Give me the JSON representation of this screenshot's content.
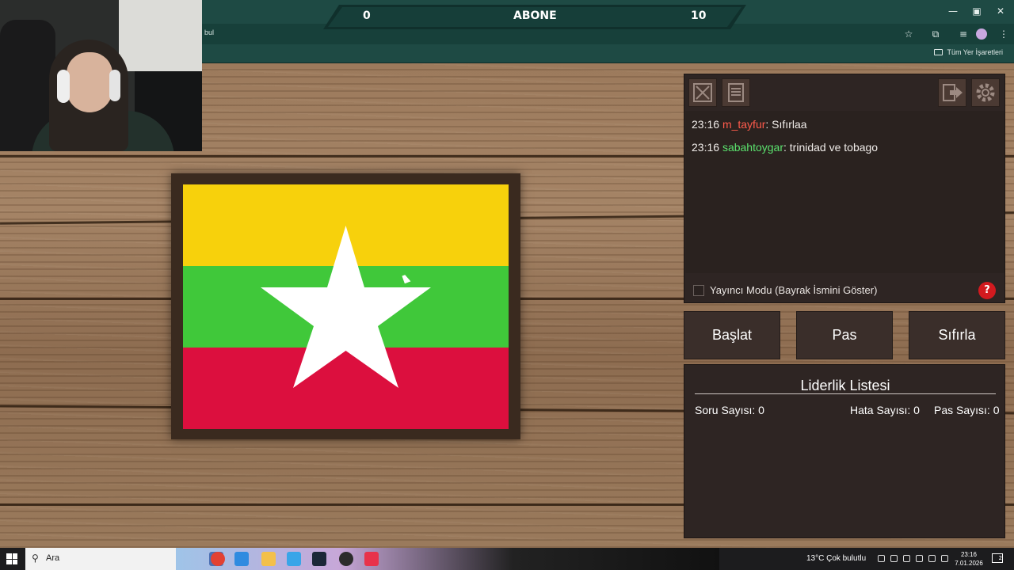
{
  "browser": {
    "address_fragment": "bul",
    "bookmarks_label": "Tüm Yer İşaretleri",
    "window_controls": [
      "minimize-icon",
      "restore-icon",
      "close-icon"
    ]
  },
  "score": {
    "left": "0",
    "label": "ABONE",
    "right": "10"
  },
  "flag": {
    "colors": {
      "top": "#f7d10c",
      "middle": "#40c83a",
      "bottom": "#dc0f3e",
      "star": "#ffffff"
    }
  },
  "toolbar": {
    "left_icons": [
      "fullscreen-icon",
      "list-icon"
    ],
    "right_icons": [
      "exit-icon",
      "settings-icon"
    ]
  },
  "chat": {
    "messages": [
      {
        "time": "23:16",
        "user": "m_tayfur",
        "text": ": Sıfırlaa"
      },
      {
        "time": "23:16",
        "user": "sabahtoygar",
        "text": ": trinidad ve tobago"
      }
    ]
  },
  "streamer_mode": {
    "label": "Yayıncı Modu (Bayrak İsmini Göster)",
    "checked": false,
    "help": "?"
  },
  "actions": {
    "start": "Başlat",
    "pass": "Pas",
    "reset": "Sıfırla"
  },
  "leaderboard": {
    "title": "Liderlik Listesi",
    "questions": "Soru Sayısı: 0",
    "errors": "Hata Sayısı: 0",
    "passes": "Pas Sayısı: 0"
  },
  "taskbar": {
    "search_placeholder": "Ara",
    "weather": "13°C  Çok bulutlu",
    "time": "23:16",
    "date": "7.01.2026",
    "notifications": "2"
  },
  "accent_colors": {
    "browser": "#1e4a44",
    "panel": "#2e2523",
    "username_red": "#ff5b4c",
    "username_green": "#5be36e",
    "help_red": "#d21a1f"
  }
}
